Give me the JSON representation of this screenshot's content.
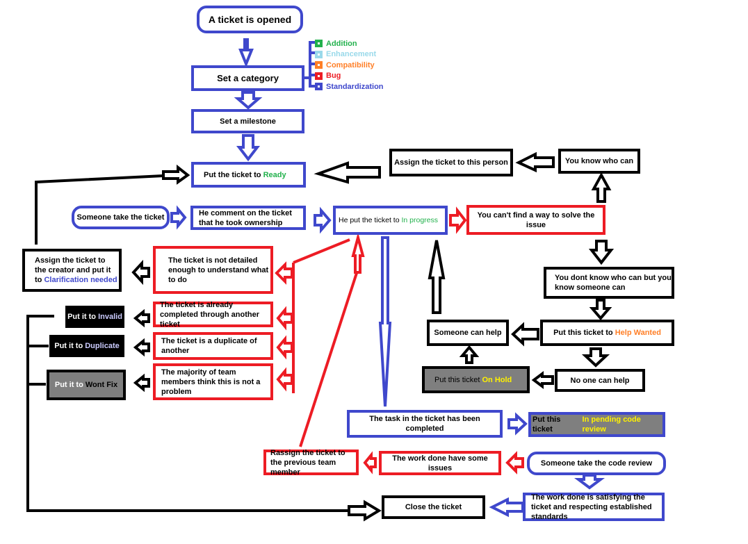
{
  "colors": {
    "blue": "#3f48cc",
    "red": "#ed1c24",
    "black": "#000000",
    "green": "#22b14c",
    "light_blue": "#99d9ea",
    "orange": "#ff7f27",
    "yellow": "#fff200",
    "gray": "#7f7f7f"
  },
  "categories": [
    {
      "label": "Addition",
      "color": "#22b14c"
    },
    {
      "label": "Enhancement",
      "color": "#99d9ea"
    },
    {
      "label": "Compatibility",
      "color": "#ff7f27"
    },
    {
      "label": "Bug",
      "color": "#ed1c24"
    },
    {
      "label": "Standardization",
      "color": "#3f48cc"
    }
  ],
  "nodes": {
    "ticket_opened": "A ticket is opened",
    "set_category": "Set a category",
    "set_milestone": "Set a milestone",
    "ready": {
      "prefix": "Put the ticket to ",
      "status": "Ready"
    },
    "someone_take": "Someone take the ticket",
    "comment_ownership": "He comment on the ticket that he took ownership",
    "in_progress": {
      "prefix": "He put the ticket to ",
      "status": "In progress"
    },
    "cant_solve": "You can't find a way to solve the issue",
    "assign_person": "Assign the ticket to this person",
    "know_who": "You know who can",
    "dont_know_who": "You dont know who can but you know someone can",
    "help_wanted": {
      "prefix": "Put this ticket to ",
      "status": "Help Wanted"
    },
    "someone_can_help": "Someone can help",
    "no_one_can_help": "No one can help",
    "on_hold": {
      "prefix": "Put this ticket ",
      "status": "On Hold"
    },
    "clarification": {
      "prefix": "Assign the ticket to the creator and put it to ",
      "status": "Clarification needed"
    },
    "not_detailed": "The ticket is not detailed enough to understand what to do",
    "already_completed": "The ticket is already completed through another ticket",
    "duplicate_of": "The ticket is a duplicate of another",
    "majority_not_problem": "The majority of team members think this is not a problem",
    "invalid": {
      "prefix": "Put it to ",
      "status": "Invalid"
    },
    "duplicate": {
      "prefix": "Put it to ",
      "status": "Duplicate"
    },
    "wont_fix": {
      "prefix": "Put it to ",
      "status": "Wont Fix"
    },
    "task_completed": "The task in the ticket has been completed",
    "pending_review": {
      "prefix": "Put this ticket ",
      "status": "In pending code review"
    },
    "take_code_review": "Someone take the code review",
    "work_issues": "The work done have some issues",
    "reassign": "Rassign the ticket to the previous team member",
    "work_satisfying": "The work done is satisfying the ticket and respecting established standards",
    "close": "Close the ticket"
  }
}
